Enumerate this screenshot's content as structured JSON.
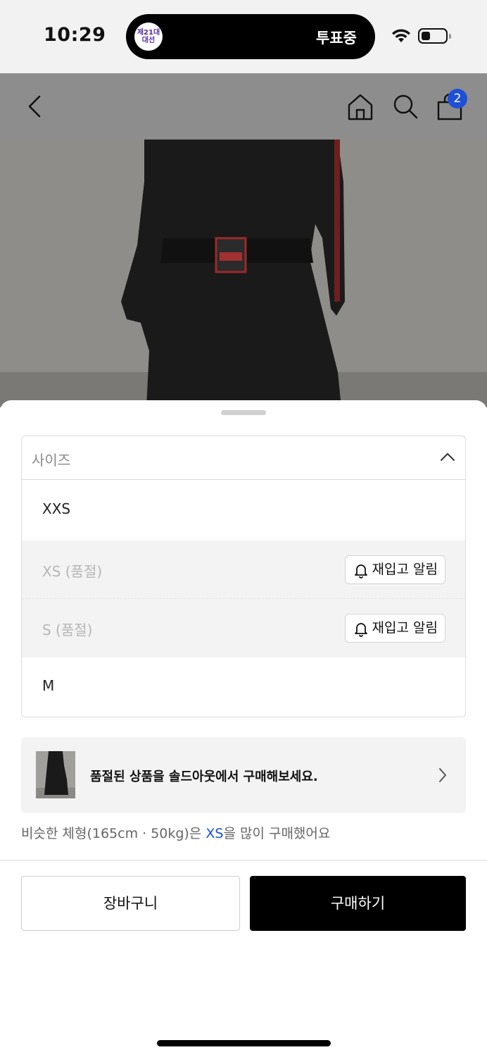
{
  "status_bar": {
    "time": "10:29",
    "island_logo_line1": "제21대",
    "island_logo_line2": "대선",
    "island_text": "투표중"
  },
  "top_nav": {
    "cart_badge_count": "2",
    "icons": [
      "back-arrow-icon",
      "home-icon",
      "search-icon",
      "shopping-bag-icon"
    ]
  },
  "size_select": {
    "placeholder": "사이즈",
    "options": [
      {
        "label": "XXS",
        "sold_out": false
      },
      {
        "label": "XS (품절)",
        "sold_out": true,
        "restock_label": "재입고 알림"
      },
      {
        "label": "S (품절)",
        "sold_out": true,
        "restock_label": "재입고 알림"
      },
      {
        "label": "M",
        "sold_out": false
      }
    ]
  },
  "soldout_banner": {
    "text": "품절된 상품을 솔드아웃에서 구매해보세요."
  },
  "similar_body": {
    "prefix": "비슷한 체형(165cm · 50kg)은 ",
    "highlight": "XS",
    "suffix": "을 많이 구매했어요"
  },
  "actions": {
    "cart_label": "장바구니",
    "buy_label": "구매하기"
  },
  "colors": {
    "accent_blue": "#1e4fd6",
    "primary_button": "#000000",
    "soldout_row_bg": "#f3f3f3"
  }
}
